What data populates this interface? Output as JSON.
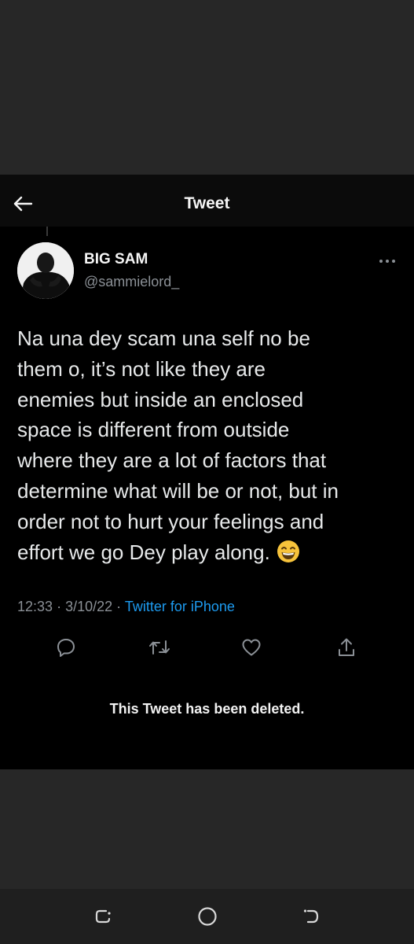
{
  "header": {
    "title": "Tweet"
  },
  "author": {
    "display_name": "BIG SAM",
    "handle": "@sammielord_"
  },
  "tweet": {
    "text": "Na una dey scam una self no be\nthem o, it’s not like they are\nenemies but inside an enclosed\nspace is different from outside\nwhere they are a lot of factors that\ndetermine what will be or not, but in\norder not to hurt your feelings and\neffort we go Dey play along.",
    "emoji": "grinning-face-with-smiling-eyes"
  },
  "meta": {
    "time": "12:33",
    "date": "3/10/22",
    "separator": "·",
    "source": "Twitter for iPhone"
  },
  "actions": [
    "reply-icon",
    "retweet-icon",
    "like-icon",
    "share-icon"
  ],
  "notice": {
    "deleted_text": "This Tweet has been deleted."
  },
  "colors": {
    "background": "#000000",
    "text": "#e7e9ea",
    "muted": "#8b9096",
    "link": "#1d9bf0"
  }
}
